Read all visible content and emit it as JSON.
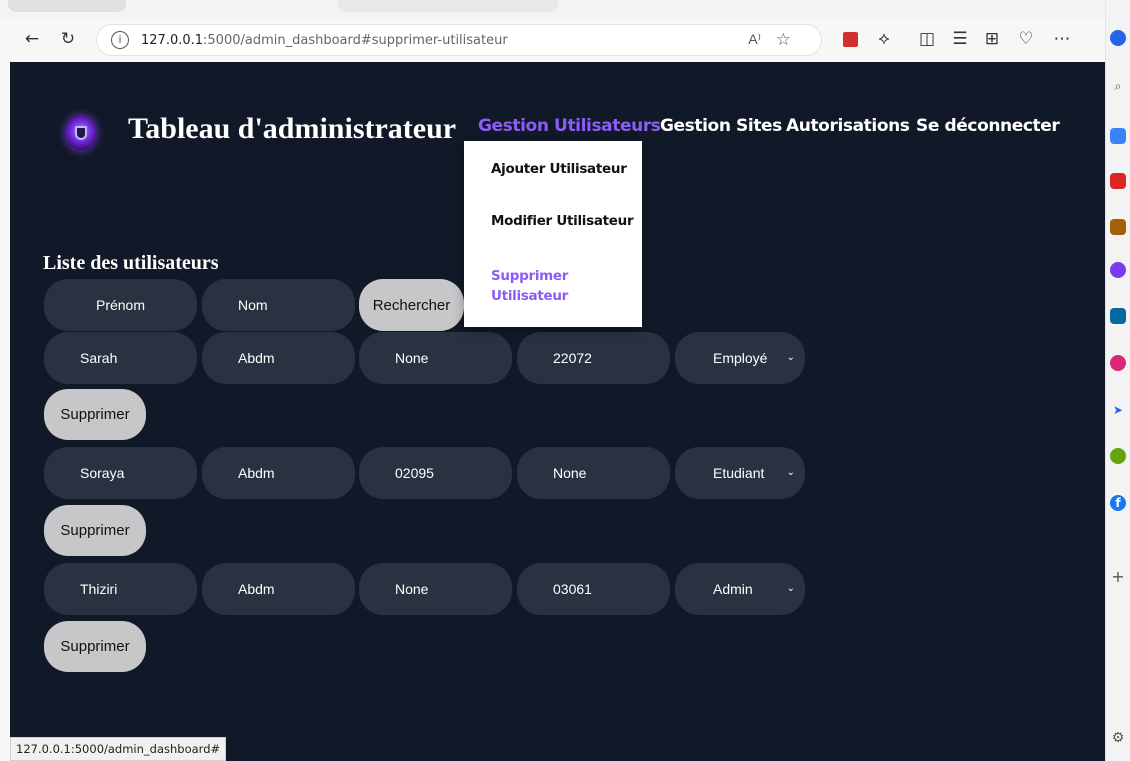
{
  "browser": {
    "url_host": "127.0.0.1",
    "url_rest": ":5000/admin_dashboard#supprimer-utilisateur",
    "status_url": "127.0.0.1:5000/admin_dashboard#",
    "read_aloud_label": "A⁾"
  },
  "page": {
    "title": "Tableau d'administrateur",
    "nav": {
      "users": "Gestion Utilisateurs",
      "sites": "Gestion Sites",
      "auth": "Autorisations",
      "logout": "Se déconnecter"
    },
    "dropdown": {
      "add": "Ajouter Utilisateur",
      "edit": "Modifier Utilisateur",
      "delete": "Supprimer Utilisateur"
    },
    "section_title": "Liste des utilisateurs",
    "search": {
      "first_placeholder": "Prénom",
      "last_placeholder": "Nom",
      "button": "Rechercher"
    },
    "delete_label": "Supprimer",
    "users": [
      {
        "first": "Sarah",
        "last": "Abdm",
        "field3": "None",
        "field4": "22072",
        "role": "Employé"
      },
      {
        "first": "Soraya",
        "last": "Abdm",
        "field3": "02095",
        "field4": "None",
        "role": "Etudiant"
      },
      {
        "first": "Thiziri",
        "last": "Abdm",
        "field3": "None",
        "field4": "03061",
        "role": "Admin"
      }
    ]
  },
  "colors": {
    "background": "#111827",
    "accent": "#8b5cf6",
    "pill": "#2a3140",
    "button": "#c7c7c9"
  }
}
